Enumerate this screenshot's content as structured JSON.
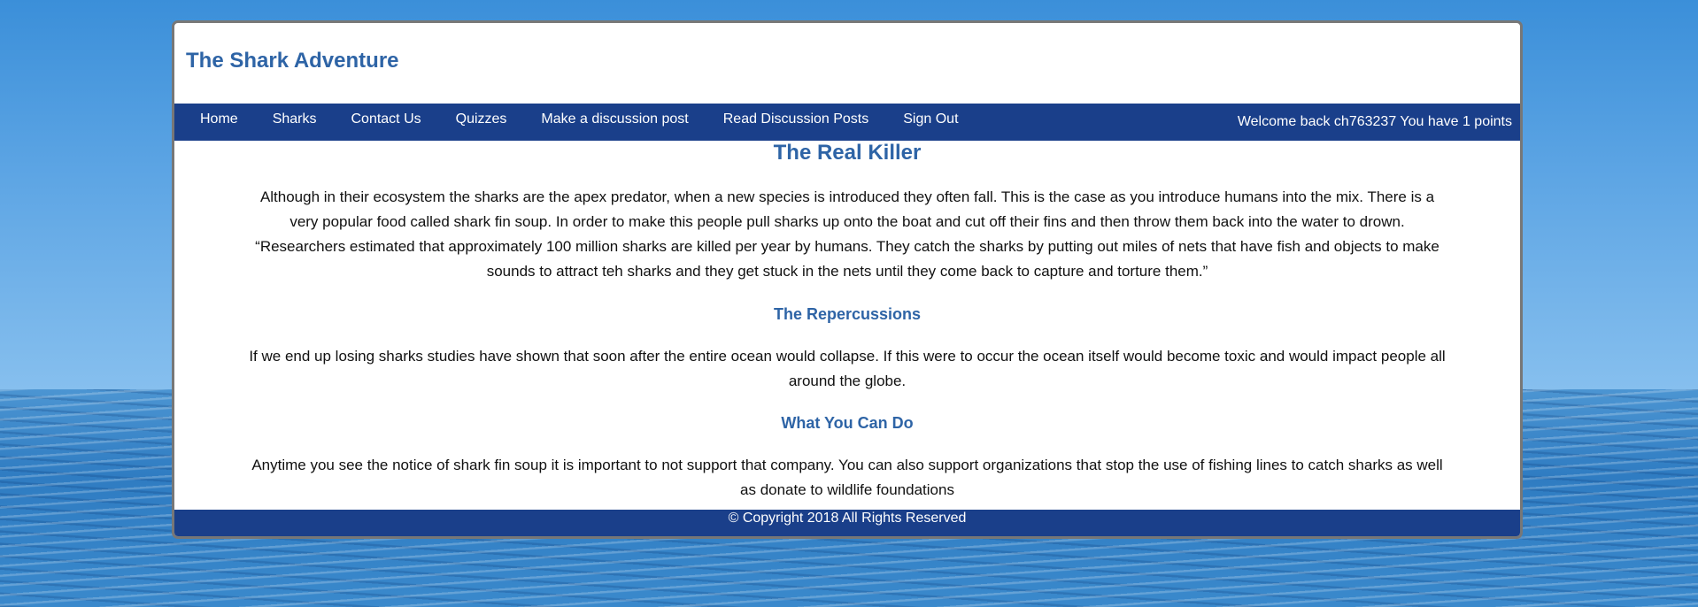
{
  "site": {
    "title": "The Shark Adventure"
  },
  "nav": {
    "items": [
      {
        "label": "Home"
      },
      {
        "label": "Sharks"
      },
      {
        "label": "Contact Us"
      },
      {
        "label": "Quizzes"
      },
      {
        "label": "Make a discussion post"
      },
      {
        "label": "Read Discussion Posts"
      },
      {
        "label": "Sign Out"
      }
    ],
    "welcome": "Welcome back ch763237 You have 1 points"
  },
  "article": {
    "title": "The Real Killer",
    "intro": "Although in their ecosystem the sharks are the apex predator, when a new species is introduced they often fall. This is the case as you introduce humans into the mix. There is a very popular food called shark fin soup. In order to make this people pull sharks up onto the boat and cut off their fins and then throw them back into the water to drown. “Researchers estimated that approximately 100 million sharks are killed per year by humans. They catch the sharks by putting out miles of nets that have fish and objects to make sounds to attract teh sharks and they get stuck in the nets until they come back to capture and torture them.”",
    "section1_title": "The Repercussions",
    "section1_text": "If we end up losing sharks studies have shown that soon after the entire ocean would collapse. If this were to occur the ocean itself would become toxic and would impact people all around the globe.",
    "section2_title": "What You Can Do",
    "section2_text": "Anytime you see the notice of shark fin soup it is important to not support that company. You can also support organizations that stop the use of fishing lines to catch sharks as well as donate to wildlife foundations"
  },
  "footer": {
    "text": "© Copyright 2018 All Rights Reserved"
  },
  "colors": {
    "brand_blue": "#2e64a6",
    "nav_bg": "#1a3f8a"
  }
}
